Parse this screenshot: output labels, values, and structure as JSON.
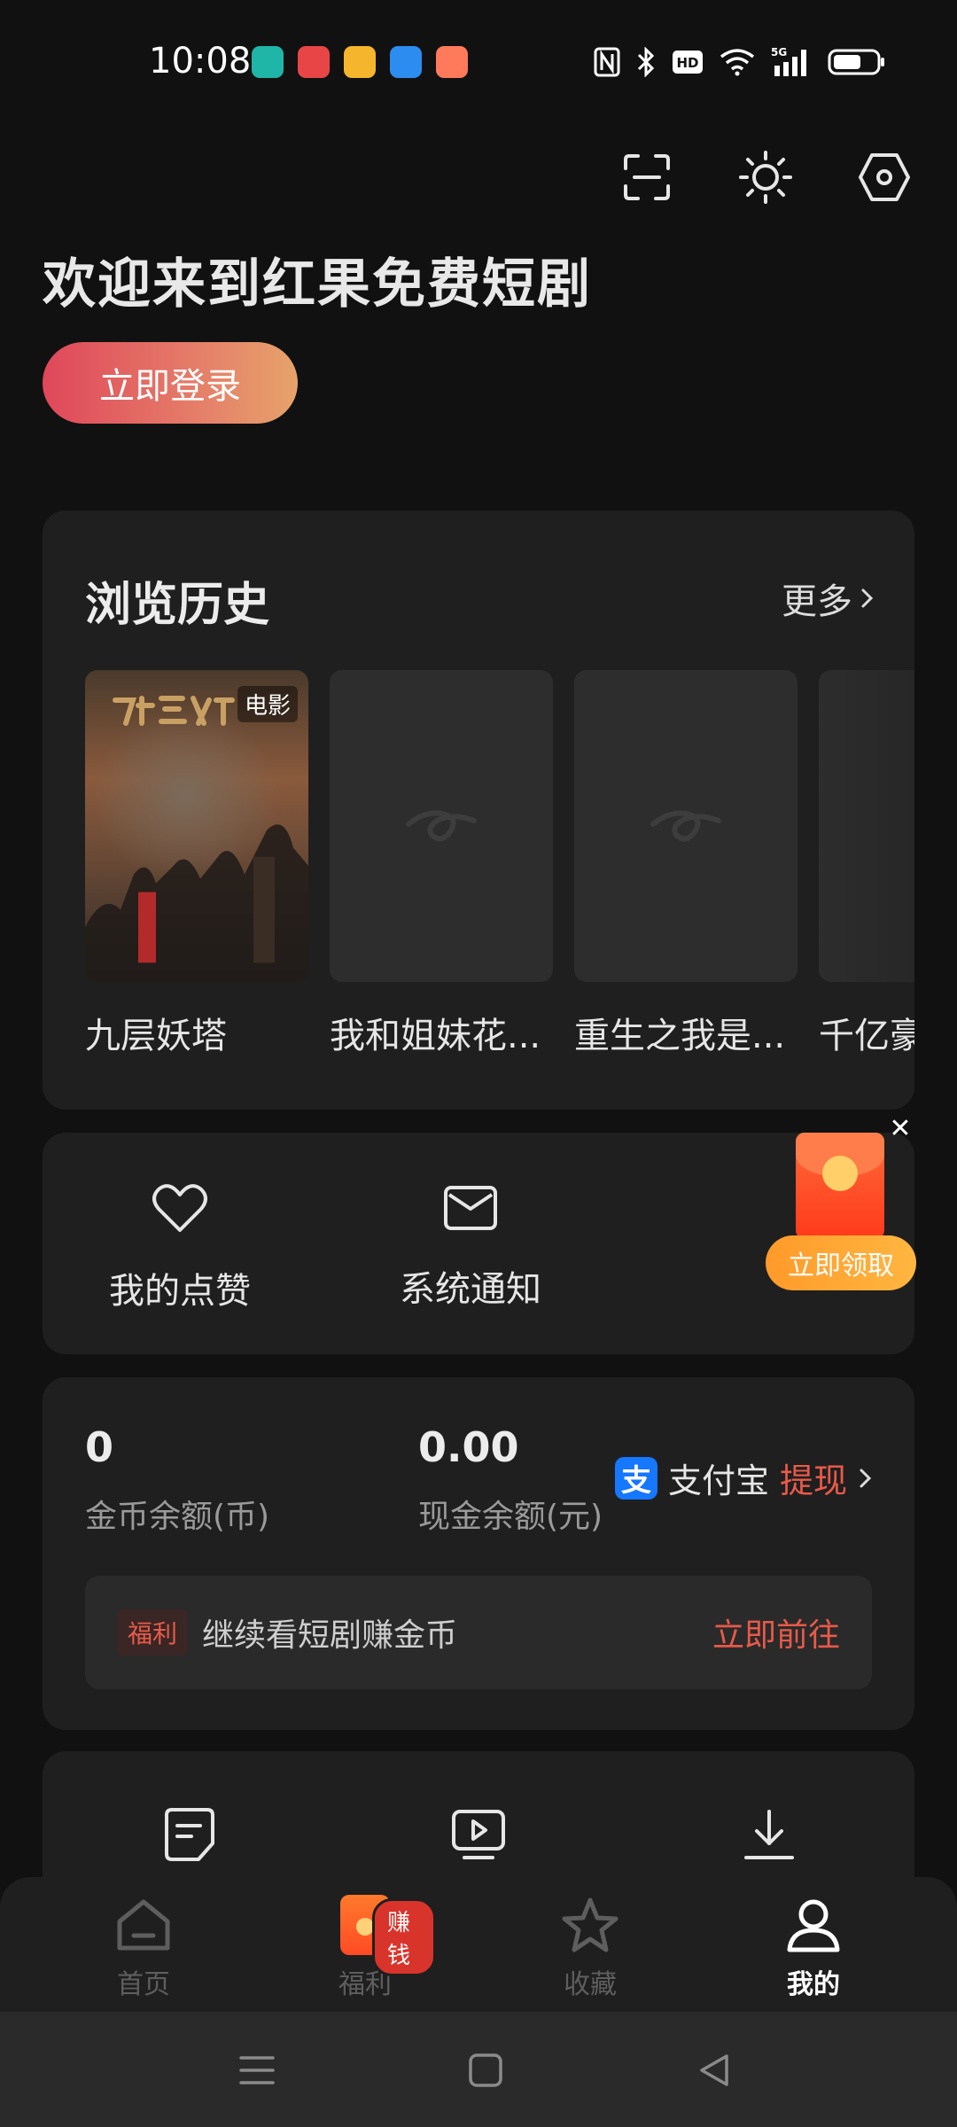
{
  "status_bar": {
    "time": "10:08",
    "app_icons": [
      {
        "name": "app-icon-1",
        "color": "#1fb6a8"
      },
      {
        "name": "app-icon-2",
        "color": "#e84646"
      },
      {
        "name": "weibo-icon",
        "color": "#f5b52c"
      },
      {
        "name": "app-icon-4",
        "color": "#2d8cf0"
      },
      {
        "name": "game-icon",
        "color": "#ff7a5a"
      }
    ],
    "network_label": "5G",
    "hd_label": "HD"
  },
  "header": {
    "welcome": "欢迎来到红果免费短剧",
    "login_button": "立即登录"
  },
  "history": {
    "title": "浏览历史",
    "more": "更多",
    "items": [
      {
        "name": "九层妖塔",
        "tag": "电影"
      },
      {
        "name": "我和姐妹花..."
      },
      {
        "name": "重生之我是..."
      },
      {
        "name": "千亿豪"
      }
    ]
  },
  "actions": {
    "likes": "我的点赞",
    "notice": "系统通知"
  },
  "red_packet": {
    "claim": "立即领取"
  },
  "balance": {
    "coin_value": "0",
    "coin_label": "金币余额(币)",
    "cash_value": "0.00",
    "cash_label": "现金余额(元)",
    "alipay_logo": "支",
    "alipay_label": "支付宝",
    "withdraw_label": "提现",
    "welfare_tag": "福利",
    "welfare_text": "继续看短剧赚金币",
    "welfare_go": "立即前往"
  },
  "tab_bar": {
    "tabs": [
      {
        "label": "首页"
      },
      {
        "label": "福利",
        "badge": "赚钱"
      },
      {
        "label": "收藏"
      },
      {
        "label": "我的"
      }
    ]
  },
  "colors": {
    "accent_red": "#e85a4a",
    "background": "#111111",
    "card": "#1f1f1f"
  }
}
